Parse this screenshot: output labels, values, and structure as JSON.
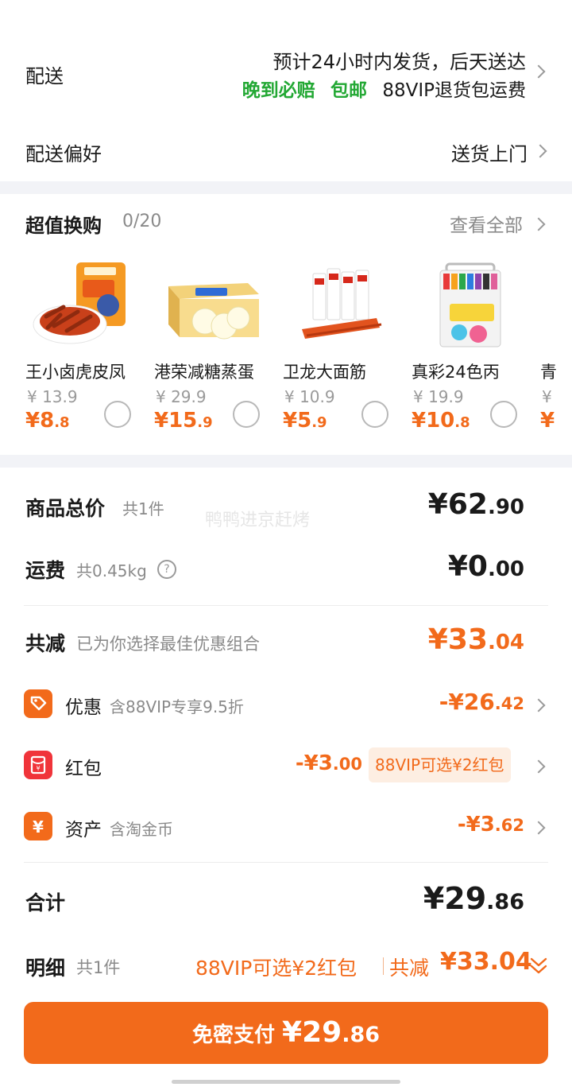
{
  "delivery": {
    "label": "配送",
    "line1": "预计24小时内发货，后天送达",
    "tag_late": "晚到必赔",
    "tag_free": "包邮",
    "tag_return": "88VIP退货包运费"
  },
  "preference": {
    "label": "配送偏好",
    "value": "送货上门"
  },
  "exchange": {
    "title": "超值换购",
    "count": "0/20",
    "view_all": "查看全部",
    "items": [
      {
        "name": "王小卤虎皮凤",
        "old_price": "¥ 13.9",
        "price_int": "¥8",
        "price_dec": ".8"
      },
      {
        "name": "港荣减糖蒸蛋",
        "old_price": "¥ 29.9",
        "price_int": "¥15",
        "price_dec": ".9"
      },
      {
        "name": "卫龙大面筋",
        "old_price": "¥ 10.9",
        "price_int": "¥5",
        "price_dec": ".9"
      },
      {
        "name": "真彩24色丙",
        "old_price": "¥ 19.9",
        "price_int": "¥10",
        "price_dec": ".8"
      },
      {
        "name": "青",
        "old_price": "¥",
        "price_int": "¥",
        "price_dec": ""
      }
    ]
  },
  "summary": {
    "goods_label": "商品总价",
    "goods_count": "共1件",
    "goods_int": "¥62",
    "goods_dec": ".90",
    "watermark": "鸭鸭进京赶烤",
    "ship_label": "运费",
    "ship_weight": "共0.45kg",
    "ship_int": "¥0",
    "ship_dec": ".00",
    "reduce_label": "共减",
    "reduce_note": "已为你选择最佳优惠组合",
    "reduce_int": "¥33",
    "reduce_dec": ".04",
    "discount_label": "优惠",
    "discount_note": "含88VIP专享9.5折",
    "discount_int": "-¥26",
    "discount_dec": ".42",
    "redpack_label": "红包",
    "redpack_int": "-¥3",
    "redpack_dec": ".00",
    "redpack_tag": "88VIP可选¥2红包",
    "asset_label": "资产",
    "asset_note": "含淘金币",
    "asset_int": "-¥3",
    "asset_dec": ".62",
    "total_label": "合计",
    "total_int": "¥29",
    "total_dec": ".86"
  },
  "detail": {
    "label": "明细",
    "count": "共1件",
    "vip_note": "88VIP可选¥2红包",
    "reduce_label": "共减",
    "reduce_value": "¥33.04"
  },
  "pay": {
    "label": "免密支付",
    "int": "¥29",
    "dec": ".86"
  },
  "colors": {
    "accent": "#f26a1b",
    "green": "#23a834",
    "background_band": "#f2f3f7"
  }
}
